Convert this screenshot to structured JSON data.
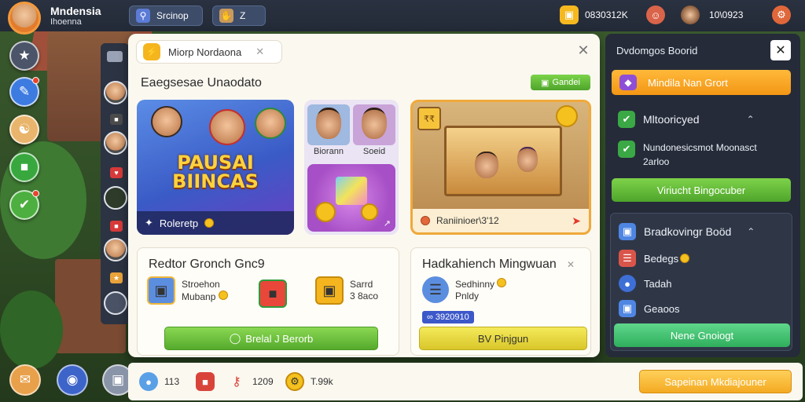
{
  "user": {
    "name": "Mndensia",
    "subtitle": "Ihoenna"
  },
  "topbar": {
    "search_label": "Srcinop",
    "tool_label": "Z",
    "currency1": "0830312K",
    "currency2": "10\\0923"
  },
  "modal": {
    "header_label": "Miorp Nordaona",
    "section_title": "Eaegsesae Unaodato",
    "corner_button": "Gandei",
    "promo": {
      "title": "PAUSAI BIINCAS",
      "footer": "Roleretp"
    },
    "friends": [
      {
        "label": "Biorann"
      },
      {
        "label": "Soeid"
      }
    ],
    "shop": {
      "tag": "₹₹",
      "footer": "Raniinioer\\3'12"
    },
    "growth": {
      "title": "Redtor Gronch Gnc9",
      "item1_line1": "Stroehon",
      "item1_line2": "Mubanp",
      "item2_line1": "Sarrd",
      "item2_line2": "3 8aco",
      "button": "Brelal J Berorb"
    },
    "mission": {
      "title": "Hadkahiench Mingwuan",
      "item_line1": "Sedhinny",
      "item_line2": "Pnldy",
      "tag": "∞ 3920910",
      "button": "BV Pinjgun"
    }
  },
  "right_panel": {
    "title": "Dvdomgos Boorid",
    "orange_button": "Mindila Nan Grort",
    "row1": "Mltooricyed",
    "row2_line1": "Nundonesicsmot Moonasct",
    "row2_line2": "2arloo",
    "green_button": "Viriucht Bingocuber",
    "box": {
      "title": "Bradkovingr Boöd",
      "row1": "Bedegs",
      "row2": "Tadah",
      "row3": "Geaoos",
      "button": "Nene Gnoiogt"
    }
  },
  "bottom": {
    "stat1": "113",
    "stat2": "1209",
    "stat3": "T.99k",
    "action": "Sapeinan Mkdiajouner"
  },
  "colors": {
    "accent_orange": "#f39614",
    "accent_green": "#55aa2c",
    "panel_dark": "#252b39",
    "modal_bg": "#fbf8f0"
  }
}
